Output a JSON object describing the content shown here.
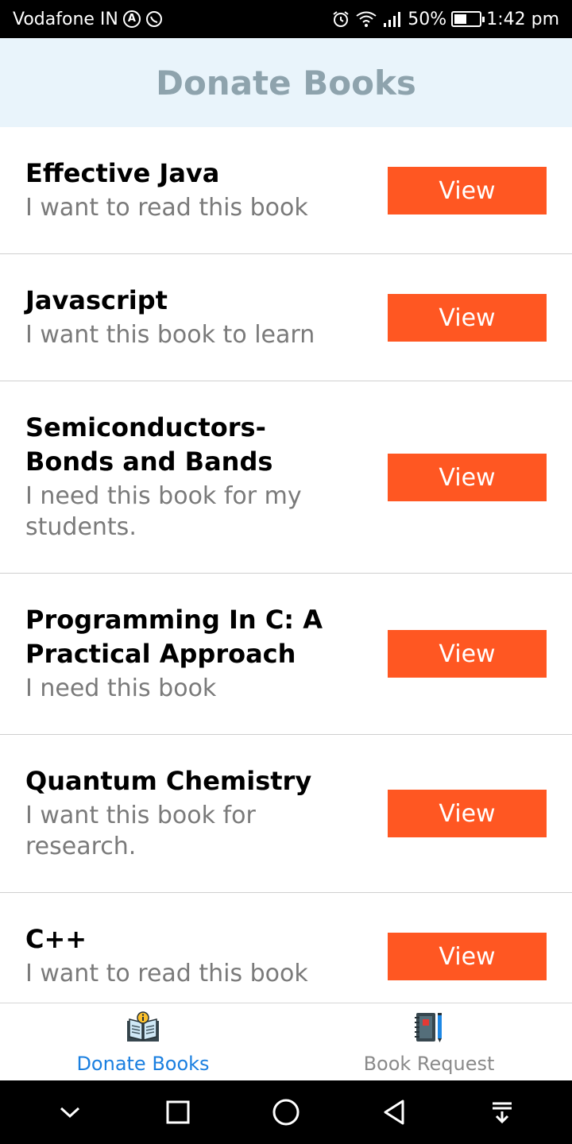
{
  "status_bar": {
    "carrier": "Vodafone IN",
    "battery": "50%",
    "battery_level": 0.5,
    "time": "1:42 pm",
    "icons": [
      "carrier-a-icon",
      "whatsapp-icon",
      "alarm-icon",
      "wifi-icon",
      "signal-icon",
      "battery-icon"
    ]
  },
  "header": {
    "title": "Donate Books"
  },
  "books": [
    {
      "title": "Effective Java",
      "reason": "I want to read this book",
      "button": "View"
    },
    {
      "title": "Javascript",
      "reason": "I want this book to learn",
      "button": "View"
    },
    {
      "title": "Semiconductors-Bonds and Bands",
      "reason": "I need this book for my students.",
      "button": "View"
    },
    {
      "title": "Programming In C: A Practical Approach",
      "reason": "I need this book",
      "button": "View"
    },
    {
      "title": "Quantum Chemistry",
      "reason": "I want this book for research.",
      "button": "View"
    },
    {
      "title": "C++",
      "reason": "I want to read this book",
      "button": "View"
    }
  ],
  "tabs": [
    {
      "label": "Donate Books",
      "icon": "open-book-icon",
      "active": true
    },
    {
      "label": "Book Request",
      "icon": "notebook-pencil-icon",
      "active": false
    }
  ],
  "nav_bar": {
    "icons": [
      "chevron-down-icon",
      "recents-icon",
      "home-icon",
      "back-icon",
      "notification-pull-icon"
    ]
  },
  "colors": {
    "header_bg": "#e9f4fb",
    "header_text": "#8ea3ad",
    "button_bg": "#ff5722",
    "active_tab": "#1a7fe0",
    "inactive_tab": "#8a8a8a"
  }
}
